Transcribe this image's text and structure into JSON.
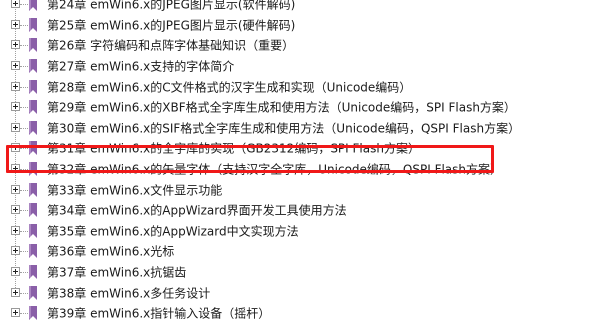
{
  "tree": {
    "items": [
      {
        "label": "第24章 emWin6.x的JPEG图片显示(软件解码)"
      },
      {
        "label": "第25章 emWin6.x的JPEG图片显示(硬件解码)"
      },
      {
        "label": "第26章 字符编码和点阵字体基础知识（重要）"
      },
      {
        "label": "第27章 emWin6.x支持的字体简介"
      },
      {
        "label": "第28章 emWin6.x的C文件格式的汉字生成和实现（Unicode编码）"
      },
      {
        "label": "第29章 emWin6.x的XBF格式全字库生成和使用方法（Unicode编码，SPI Flash方案）"
      },
      {
        "label": "第30章 emWin6.x的SIF格式全字库生成和使用方法（Unicode编码，QSPI Flash方案）"
      },
      {
        "label": "第31章 emWin6.x的全字库的实现（GB2312编码，SPI Flash方案）"
      },
      {
        "label": "第32章 emWin6.x的矢量字体（支持汉字全字库，Unicode编码，QSPI Flash方案）",
        "highlighted": true
      },
      {
        "label": "第33章 emWin6.x文件显示功能"
      },
      {
        "label": "第34章 emWin6.x的AppWizard界面开发工具使用方法"
      },
      {
        "label": "第35章 emWin6.x的AppWizard中文实现方法"
      },
      {
        "label": "第36章 emWin6.x光标"
      },
      {
        "label": "第37章 emWin6.x抗锯齿"
      },
      {
        "label": "第38章 emWin6.x多任务设计"
      },
      {
        "label": "第39章 emWin6.x指针输入设备（摇杆）"
      }
    ]
  },
  "colors": {
    "bookmark": "#8a5fa8",
    "highlight": "#f01818"
  },
  "icons": {
    "expander": "plus-box-icon",
    "bookmark": "bookmark-icon"
  }
}
